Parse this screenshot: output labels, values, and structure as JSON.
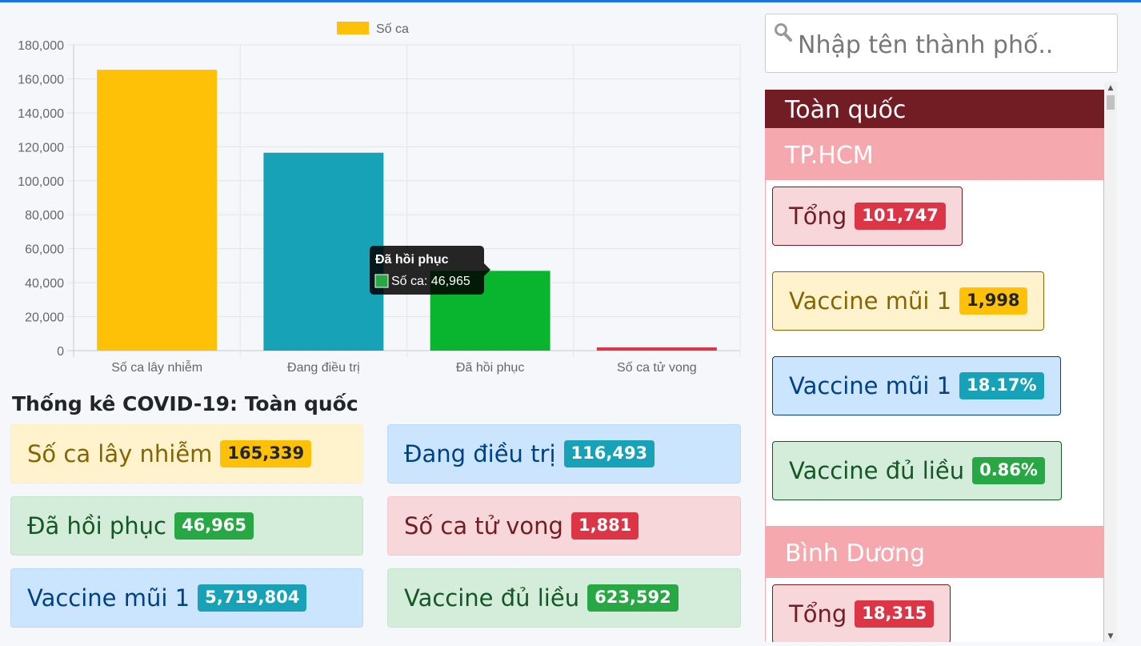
{
  "chart_data": {
    "type": "bar",
    "categories": [
      "Số ca lây nhiễm",
      "Đang điều trị",
      "Đã hồi phục",
      "Số ca tử vong"
    ],
    "series": [
      {
        "name": "Số ca",
        "values": [
          165339,
          116493,
          46965,
          1881
        ]
      }
    ],
    "bar_colors": [
      "#ffc107",
      "#17a2b8",
      "#09b52f",
      "#dc3545"
    ],
    "legend_color": "#ffc107",
    "ylim": [
      0,
      180000
    ],
    "y_ticks": [
      "0",
      "20,000",
      "40,000",
      "60,000",
      "80,000",
      "100,000",
      "120,000",
      "140,000",
      "160,000",
      "180,000"
    ],
    "grid": true,
    "legend": "top",
    "tooltip": {
      "title": "Đã hồi phục",
      "label": "Số ca: 46,965",
      "color": "#28a745",
      "category_index": 2
    }
  },
  "stats": {
    "title": "Thống kê COVID-19: Toàn quốc",
    "items": [
      {
        "label": "Số ca lây nhiễm",
        "value": "165,339"
      },
      {
        "label": "Đang điều trị",
        "value": "116,493"
      },
      {
        "label": "Đã hồi phục",
        "value": "46,965"
      },
      {
        "label": "Số ca tử vong",
        "value": "1,881"
      },
      {
        "label": "Vaccine mũi 1",
        "value": "5,719,804"
      },
      {
        "label": "Vaccine đủ liều",
        "value": "623,592"
      }
    ]
  },
  "search": {
    "placeholder": "Nhập tên thành phố.."
  },
  "panel": {
    "national": "Toàn quốc",
    "cities": [
      {
        "name": "TP.HCM",
        "stats": [
          {
            "label": "Tổng",
            "value": "101,747"
          },
          {
            "label": "Vaccine mũi 1",
            "value": "1,998"
          },
          {
            "label": "Vaccine mũi 1",
            "value": "18.17%"
          },
          {
            "label": "Vaccine đủ liều",
            "value": "0.86%"
          }
        ]
      },
      {
        "name": "Bình Dương",
        "stats": [
          {
            "label": "Tổng",
            "value": "18,315"
          }
        ]
      }
    ]
  }
}
